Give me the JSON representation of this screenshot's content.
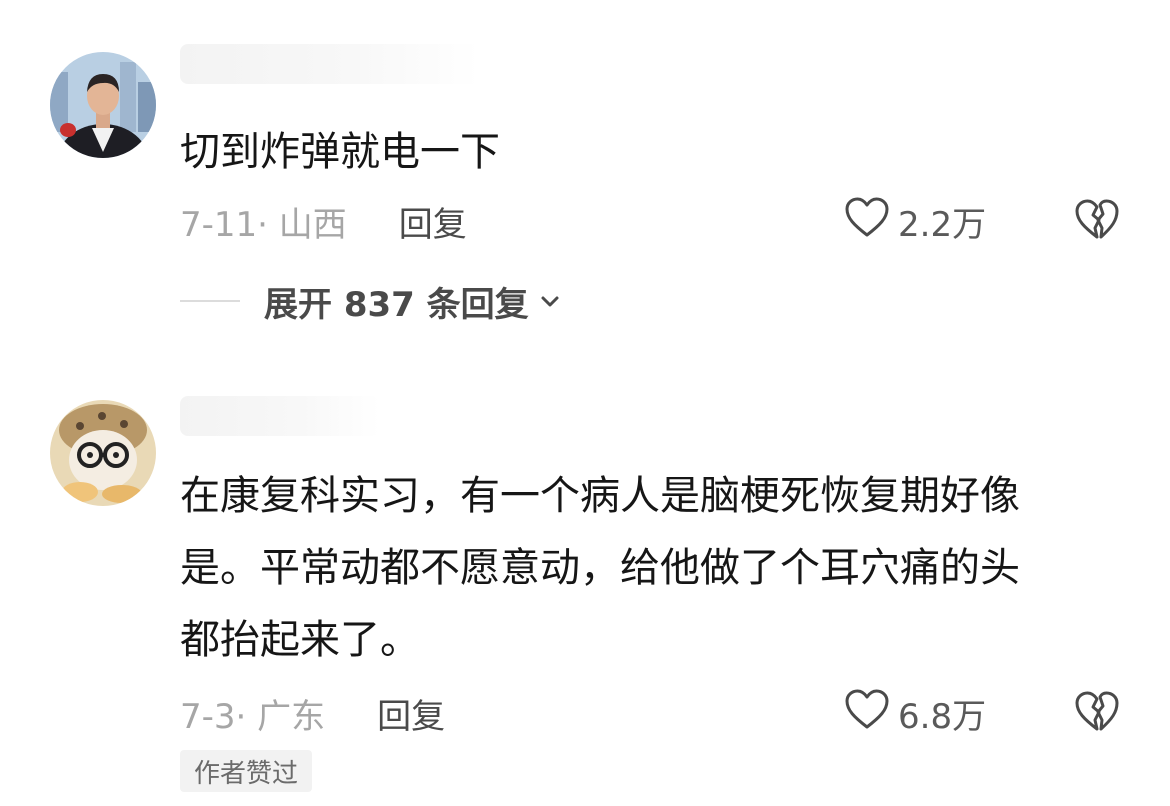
{
  "comments": [
    {
      "text": "切到炸弹就电一下",
      "date_location": "7-11· 山西",
      "reply_label": "回复",
      "likes": "2.2万",
      "expand_label": "展开 837 条回复"
    },
    {
      "text": "在康复科实习，有一个病人是脑梗死恢复期好像\n是。平常动都不愿意动，给他做了个耳穴痛的头\n都抬起来了。",
      "date_location": "7-3· 广东",
      "reply_label": "回复",
      "likes": "6.8万",
      "badge": "作者赞过"
    }
  ],
  "colors": {
    "text": "#161616",
    "meta": "#a6a6a6",
    "action": "#4a4a4a",
    "badge_bg": "#f2f2f2"
  },
  "icons": {
    "avatar_1": "man-in-suit-avatar",
    "avatar_2": "cartoon-glasses-avatar",
    "like": "heart-outline-icon",
    "dislike": "broken-heart-icon",
    "expand": "chevron-down-icon"
  }
}
